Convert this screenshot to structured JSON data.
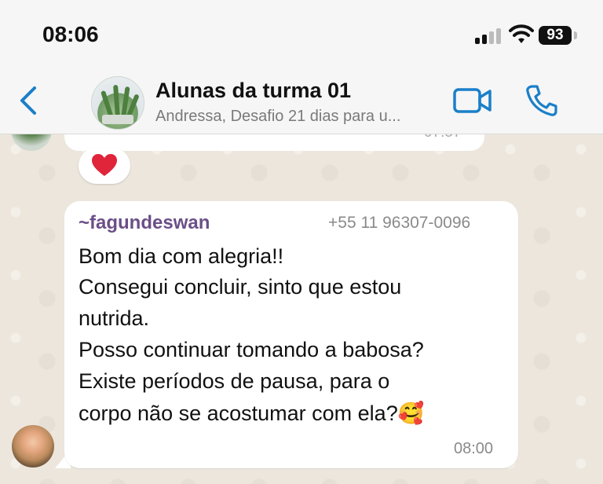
{
  "status_bar": {
    "time": "08:06",
    "battery": "93"
  },
  "header": {
    "title": "Alunas da turma 01",
    "subtitle": "Andressa, Desafio 21 dias para u...",
    "accent_color": "#1a7fc9"
  },
  "previous_message": {
    "time": "07:57",
    "reaction": "heart"
  },
  "message": {
    "sender": "~fagundeswan",
    "sender_phone": "+55 11 96307-0096",
    "lines": [
      "Bom dia com alegria!!",
      "Consegui concluir, sinto que estou",
      "nutrida.",
      "Posso continuar tomando a babosa?",
      "Existe períodos de pausa, para o",
      "corpo não se acostumar com ela?🥰"
    ],
    "time": "08:00"
  }
}
